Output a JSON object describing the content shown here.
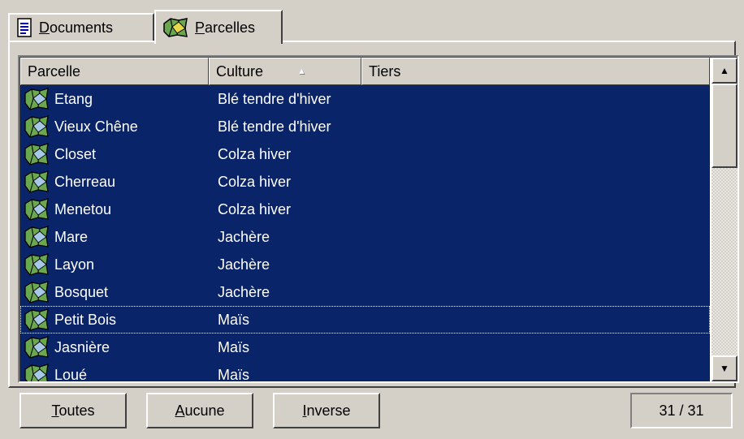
{
  "tabs": [
    {
      "label_accel": "D",
      "label_rest": "ocuments",
      "icon": "document-icon",
      "active": false
    },
    {
      "label_accel": "P",
      "label_rest": "arcelles",
      "icon": "parcel-map-icon",
      "active": true
    }
  ],
  "list": {
    "columns": [
      {
        "label": "Parcelle"
      },
      {
        "label": "Culture",
        "sorted": "ascending"
      },
      {
        "label": "Tiers"
      }
    ],
    "rows": [
      {
        "parcelle": "Etang",
        "culture": "Blé tendre d'hiver"
      },
      {
        "parcelle": "Vieux Chêne",
        "culture": "Blé tendre d'hiver"
      },
      {
        "parcelle": "Closet",
        "culture": "Colza hiver"
      },
      {
        "parcelle": "Cherreau",
        "culture": "Colza hiver"
      },
      {
        "parcelle": "Menetou",
        "culture": "Colza hiver"
      },
      {
        "parcelle": "Mare",
        "culture": "Jachère"
      },
      {
        "parcelle": "Layon",
        "culture": "Jachère"
      },
      {
        "parcelle": "Bosquet",
        "culture": "Jachère"
      },
      {
        "parcelle": "Petit Bois",
        "culture": "Maïs",
        "focused": true
      },
      {
        "parcelle": "Jasnière",
        "culture": "Maïs"
      },
      {
        "parcelle": "Loué",
        "culture": "Maïs"
      }
    ],
    "row_icon": "parcel-icon",
    "selection_color": "#0a246a"
  },
  "buttons": {
    "toutes": {
      "accel": "T",
      "rest": "outes"
    },
    "aucune": {
      "accel": "A",
      "rest": "ucune"
    },
    "inverse": {
      "accel": "I",
      "rest": "nverse"
    }
  },
  "counter": "31 / 31"
}
